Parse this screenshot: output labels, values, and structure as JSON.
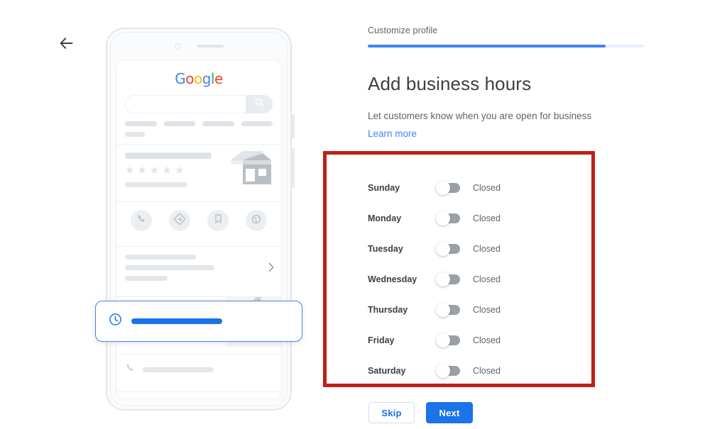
{
  "nav": {
    "back_icon": "arrow-left-icon"
  },
  "header": {
    "step_label": "Customize profile",
    "progress_percent": 86,
    "progress_color": "#4285f4",
    "progress_track_color": "#e8f0fe"
  },
  "main": {
    "title": "Add business hours",
    "subtitle": "Let customers know when you are open for business",
    "learn_more_label": "Learn more",
    "learn_more_color": "#4285f4"
  },
  "hours": {
    "rows": [
      {
        "day": "Sunday",
        "state": "Closed",
        "enabled": false
      },
      {
        "day": "Monday",
        "state": "Closed",
        "enabled": false
      },
      {
        "day": "Tuesday",
        "state": "Closed",
        "enabled": false
      },
      {
        "day": "Wednesday",
        "state": "Closed",
        "enabled": false
      },
      {
        "day": "Thursday",
        "state": "Closed",
        "enabled": false
      },
      {
        "day": "Friday",
        "state": "Closed",
        "enabled": false
      },
      {
        "day": "Saturday",
        "state": "Closed",
        "enabled": false
      }
    ]
  },
  "annotation": {
    "color": "#bf2019",
    "shape": "rectangle"
  },
  "footer": {
    "skip_label": "Skip",
    "next_label": "Next",
    "next_color": "#1a73e8",
    "skip_text_color": "#1a73e8"
  },
  "preview": {
    "google_logo": {
      "letters": [
        {
          "char": "G",
          "color": "#4285f4"
        },
        {
          "char": "o",
          "color": "#ea4335"
        },
        {
          "char": "o",
          "color": "#fbbc05"
        },
        {
          "char": "g",
          "color": "#4285f4"
        },
        {
          "char": "l",
          "color": "#34a853"
        },
        {
          "char": "e",
          "color": "#ea4335"
        }
      ]
    },
    "search_icon": "search-icon",
    "rating_stars": 5,
    "actions": [
      {
        "icon": "phone-icon"
      },
      {
        "icon": "directions-icon"
      },
      {
        "icon": "bookmark-icon"
      },
      {
        "icon": "globe-icon"
      }
    ],
    "map": {
      "pin_icon": "map-pin-icon"
    },
    "rows": [
      {
        "icon": "phone-icon"
      },
      {
        "icon": "globe-icon"
      }
    ],
    "hours_card": {
      "icon": "clock-icon",
      "icon_color": "#1a73e8",
      "bar_color": "#1a73e8",
      "border_color": "#4285f4"
    },
    "chevron_icon": "chevron-right-icon"
  }
}
